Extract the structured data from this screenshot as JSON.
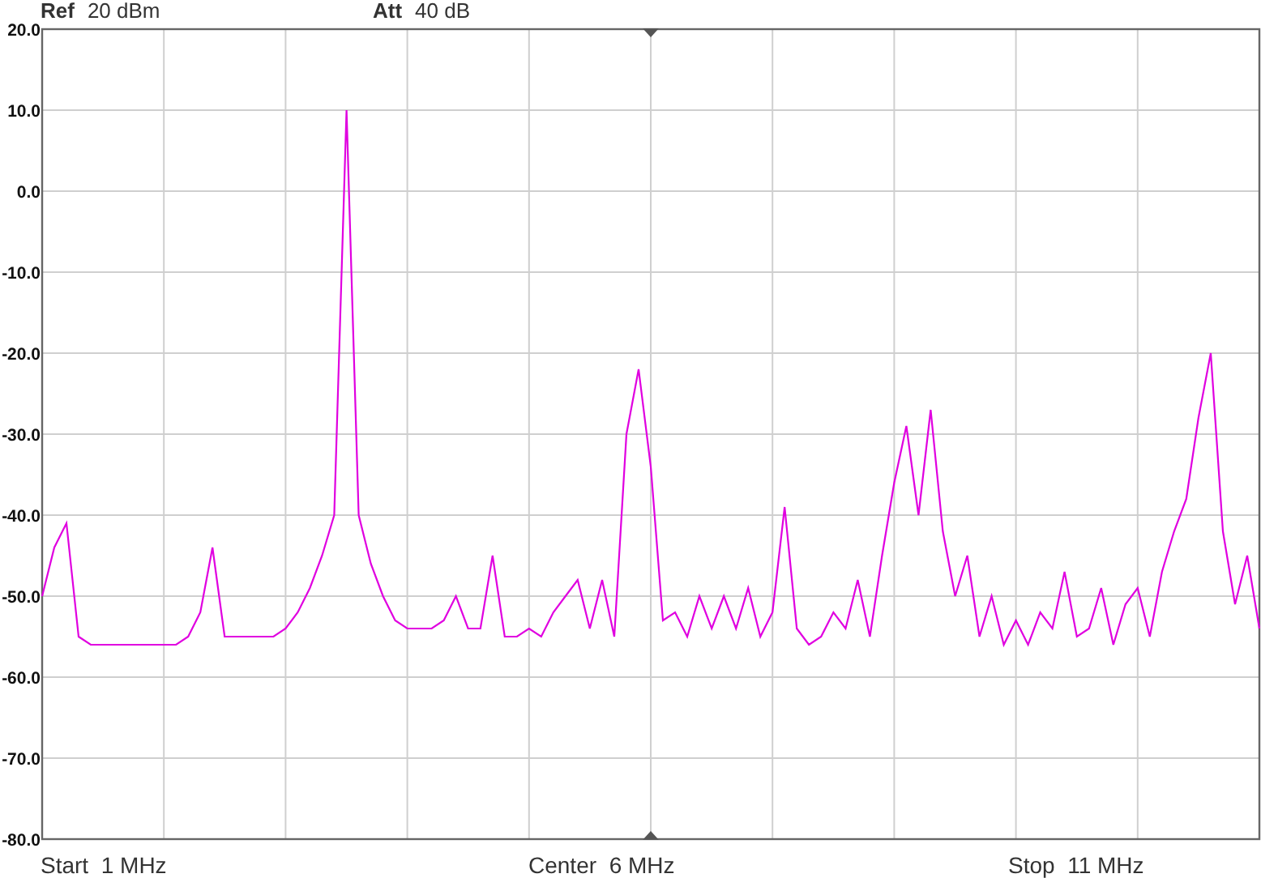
{
  "header": [
    {
      "label": "Ref",
      "value": "20 dBm"
    },
    {
      "label": "Att",
      "value": "40 dB"
    }
  ],
  "spectrum": {
    "chart_data": {
      "type": "line",
      "ylim": [
        -80,
        20
      ],
      "yticks": [
        {
          "value": 20,
          "label": "20.0"
        },
        {
          "value": 10,
          "label": "10.0"
        },
        {
          "value": 0,
          "label": "0.0"
        },
        {
          "value": -10,
          "label": "-10.0"
        },
        {
          "value": -20,
          "label": "-20.0"
        },
        {
          "value": -30,
          "label": "-30.0"
        },
        {
          "value": -40,
          "label": "-40.0"
        },
        {
          "value": -50,
          "label": "-50.0"
        },
        {
          "value": -60,
          "label": "-60.0"
        },
        {
          "value": -70,
          "label": "-70.0"
        },
        {
          "value": -80,
          "label": "-80.0"
        }
      ],
      "grid": true,
      "categories": [
        null,
        null,
        null,
        null,
        null,
        null,
        null,
        null,
        null,
        null,
        null,
        null,
        null,
        null,
        null,
        null,
        null,
        null,
        null,
        null,
        null,
        null,
        null,
        null,
        null,
        null,
        null,
        null,
        null,
        null,
        null,
        null,
        null,
        null,
        null,
        null,
        null,
        null,
        null,
        null,
        null,
        null,
        null,
        null,
        null,
        null,
        null,
        null,
        null,
        null,
        null,
        null,
        null,
        null,
        null,
        null,
        null,
        null,
        null,
        null,
        null,
        null,
        null,
        null,
        null,
        null,
        null,
        null,
        null,
        null,
        null,
        null,
        null,
        null,
        null,
        null,
        null,
        null,
        null,
        null,
        null,
        null,
        null,
        null,
        null,
        null,
        null,
        null,
        null,
        null,
        null,
        null,
        null,
        null,
        null,
        null,
        null,
        null,
        null,
        null,
        null
      ],
      "series": [
        {
          "color": "#e000e0",
          "values": [
            -50,
            -44,
            -41,
            -55,
            -56,
            -56,
            -56,
            -56,
            -56,
            -56,
            -56,
            -56,
            -55,
            -52,
            -44,
            -55,
            -55,
            -55,
            -55,
            -55,
            -54,
            -52,
            -49,
            -45,
            -40,
            10,
            -40,
            -46,
            -50,
            -53,
            -54,
            -54,
            -54,
            -53,
            -50,
            -54,
            -54,
            -45,
            -55,
            -55,
            -54,
            -55,
            -52,
            -50,
            -48,
            -54,
            -48,
            -55,
            -30,
            -22,
            -34,
            -53,
            -52,
            -55,
            -50,
            -54,
            -50,
            -54,
            -49,
            -55,
            -52,
            -39,
            -54,
            -56,
            -55,
            -52,
            -54,
            -48,
            -55,
            -45,
            -36,
            -29,
            -40,
            -27,
            -42,
            -50,
            -45,
            -55,
            -50,
            -56,
            -53,
            -56,
            -52,
            -54,
            -47,
            -55,
            -54,
            -49,
            -56,
            -51,
            -49,
            -55,
            -47,
            -42,
            -38,
            -28,
            -20,
            -42,
            -51,
            -45,
            -54
          ]
        }
      ]
    }
  },
  "sweep": [
    {
      "label": "Start",
      "value": "1 MHz"
    },
    {
      "label": "Center",
      "value": "6 MHz"
    },
    {
      "label": "Stop",
      "value": "11 MHz"
    }
  ]
}
